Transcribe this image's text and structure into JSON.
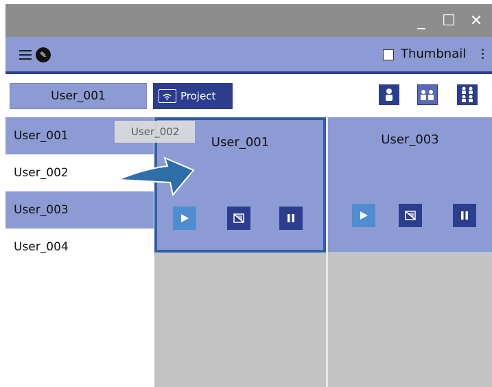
{
  "window": {
    "min_glyph": "_",
    "max_glyph": "☐",
    "close_glyph": "✕"
  },
  "menubar": {
    "thumbnail_label": "Thumbnail"
  },
  "toolbar": {
    "current_user": "User_001",
    "project_label": "Project"
  },
  "users": [
    {
      "label": "User_001",
      "selected": true
    },
    {
      "label": "User_002",
      "selected": false
    },
    {
      "label": "User_003",
      "selected": true
    },
    {
      "label": "User_004",
      "selected": false
    }
  ],
  "tiles": [
    {
      "name": "User_001",
      "active": true
    },
    {
      "name": "User_003",
      "active": false
    }
  ],
  "drag": {
    "label": "User_002"
  },
  "colors": {
    "accent": "#2d3d8e",
    "selected_bg": "#8c9bd4",
    "active_border": "#2d5ea8",
    "arrow": "#2f6fa9"
  }
}
